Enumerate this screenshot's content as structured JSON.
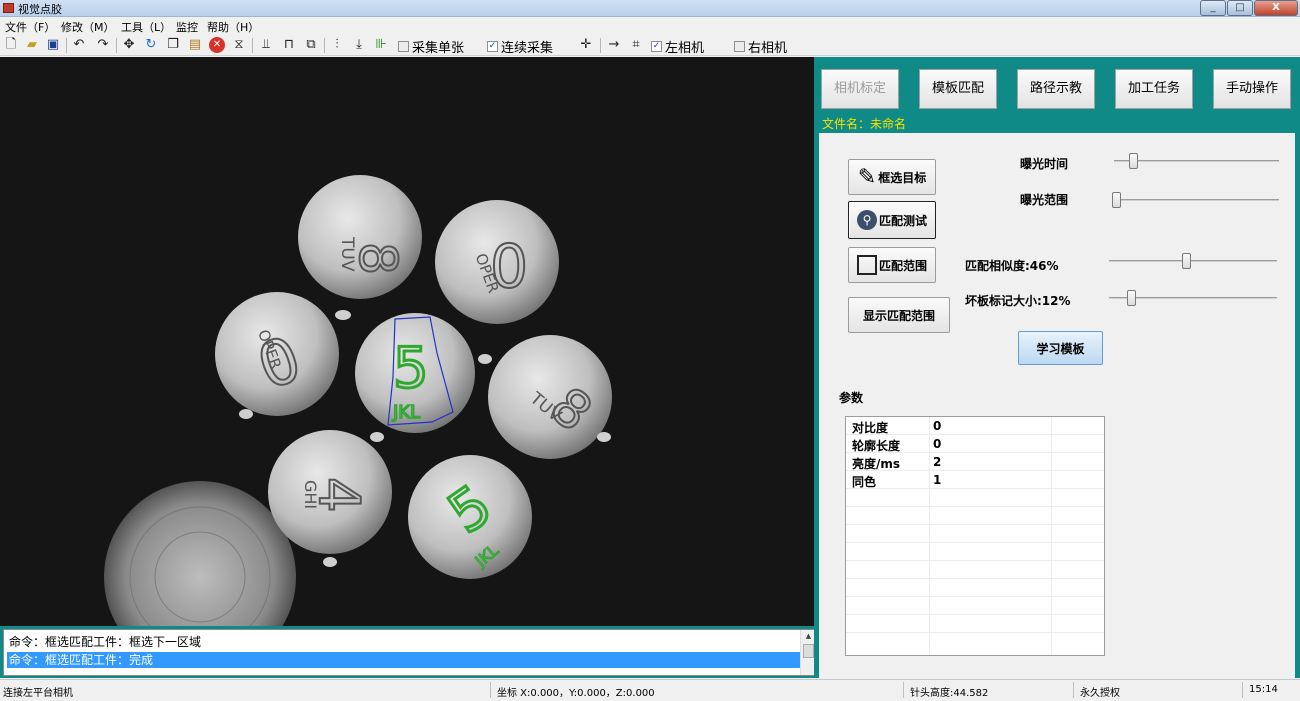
{
  "window": {
    "title": "视觉点胶",
    "controls": [
      "_",
      "□",
      "X"
    ]
  },
  "menu": [
    "文件（F）",
    "修改（M）",
    "工具（L）",
    "监控",
    "帮助（H）"
  ],
  "toolbar": {
    "checks": [
      {
        "label": "采集单张",
        "checked": false
      },
      {
        "label": "连续采集",
        "checked": true
      },
      {
        "label": "左相机",
        "checked": true
      },
      {
        "label": "右相机",
        "checked": false
      }
    ]
  },
  "camera": {
    "parts": [
      {
        "digit": "8",
        "text": "TUV"
      },
      {
        "digit": "0",
        "text": "OPER"
      },
      {
        "digit": "0",
        "text": "OPER"
      },
      {
        "digit": "5",
        "text": "JKL"
      },
      {
        "digit": "8",
        "text": "TUV"
      },
      {
        "digit": "4",
        "text": "GHI"
      },
      {
        "digit": "5",
        "text": "JKL"
      }
    ]
  },
  "log": {
    "lines": [
      "命令：框选匹配工件：框选下一区域",
      "命令：框选匹配工件：完成"
    ]
  },
  "panel": {
    "tabs": [
      "相机标定",
      "模板匹配",
      "路径示教",
      "加工任务",
      "手动操作"
    ],
    "filename": "文件名：未命名",
    "buttons": {
      "select_target": "框选目标",
      "match_test": "匹配测试",
      "match_range": "匹配范围",
      "show_match_range": "显示匹配范围",
      "learn": "学习模板"
    },
    "sliders": {
      "exposure_time": {
        "label": "曝光时间",
        "value": 0.1
      },
      "exposure_range": {
        "label": "曝光范围",
        "value": 0.0
      },
      "similarity": {
        "label": "匹配相似度:46%",
        "value": 0.46
      },
      "bad_mark_size": {
        "label": "坏板标记大小:12%",
        "value": 0.12
      }
    },
    "params_title": "参数",
    "params": [
      {
        "name": "对比度",
        "value": "0"
      },
      {
        "name": "轮廓长度",
        "value": "0"
      },
      {
        "name": "亮度/ms",
        "value": "2"
      },
      {
        "name": "同色",
        "value": "1"
      }
    ]
  },
  "status": {
    "camera": "连接左平台相机",
    "coords": "坐标 X:0.000，Y:0.000，Z:0.000",
    "needle": "针头高度:44.582",
    "license": "永久授权",
    "time": "15:14"
  }
}
